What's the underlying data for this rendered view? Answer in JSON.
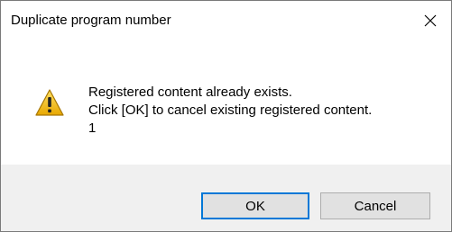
{
  "window": {
    "title": "Duplicate program number",
    "close_symbol": "✕"
  },
  "message": {
    "icon": "warning-icon",
    "lines": [
      "Registered content already exists.",
      "Click [OK] to cancel existing registered content.",
      "1"
    ]
  },
  "buttons": {
    "ok_label": "OK",
    "cancel_label": "Cancel"
  },
  "colors": {
    "warning_fill": "#f5c518",
    "focus_border": "#0078d7",
    "footer_bg": "#f0f0f0",
    "button_bg": "#e1e1e1"
  }
}
